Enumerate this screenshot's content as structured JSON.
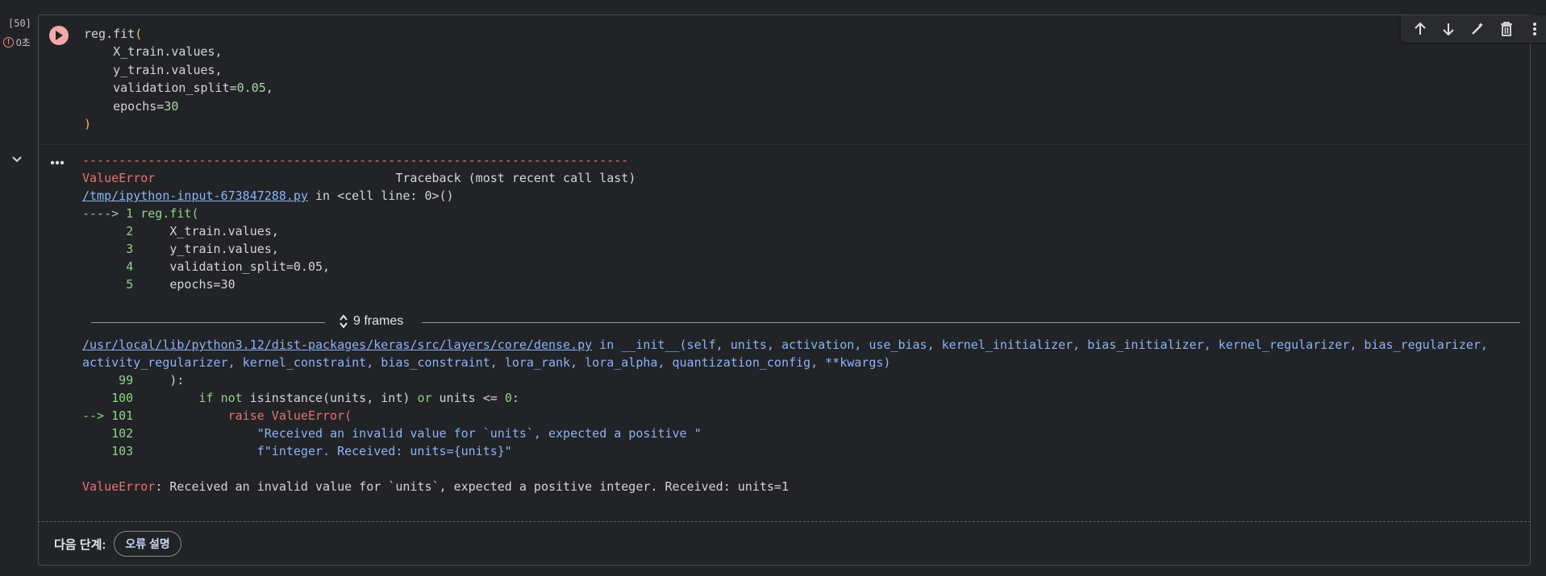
{
  "cell": {
    "exec_count": "[50]",
    "exec_status": "0초",
    "code_lines": [
      "reg.fit(",
      "    X_train.values,",
      "    y_train.values,",
      "    validation_split=0.05,",
      "    epochs=30",
      ")"
    ]
  },
  "toolbar": {
    "icons": [
      "arrow-up-icon",
      "arrow-down-icon",
      "edit-icon",
      "delete-icon",
      "more-vert-icon"
    ]
  },
  "output": {
    "separator": "---------------------------------------------------------------------------",
    "error_name": "ValueError",
    "traceback_header": "Traceback (most recent call last)",
    "input_file": "/tmp/ipython-input-673847288.py",
    "in_text": " in ",
    "cell_location": "<cell line: 0>()",
    "arrow_line_prefix": "----> 1 ",
    "arrow_line_code": "reg.fit(",
    "context_lines": [
      {
        "num": "2",
        "code": "X_train.values,"
      },
      {
        "num": "3",
        "code": "y_train.values,"
      },
      {
        "num": "4",
        "code": "validation_split=0.05,"
      },
      {
        "num": "5",
        "code": "epochs=30"
      }
    ],
    "frames_label": "9 frames",
    "lib_file": "/usr/local/lib/python3.12/dist-packages/keras/src/layers/core/dense.py",
    "func_sig_line1": " in __init__(self, units, activation, use_bias, kernel_initializer, bias_initializer, kernel_regularizer, bias_regularizer,",
    "func_sig_line2": "activity_regularizer, kernel_constraint, bias_constraint, lora_rank, lora_alpha, quantization_config, **kwargs)",
    "lib_lines": [
      {
        "num": "99",
        "code": "):"
      },
      {
        "num": "100",
        "code": "if not isinstance(units, int) or units <= 0:"
      },
      {
        "num": "101",
        "code": "raise ValueError("
      },
      {
        "num": "102",
        "code": "\"Received an invalid value for `units`, expected a positive \""
      },
      {
        "num": "103",
        "code": "f\"integer. Received: units={units}\""
      }
    ],
    "lib_arrow": "--> ",
    "final_error_name": "ValueError",
    "final_error_msg": ": Received an invalid value for `units`, expected a positive integer. Received: units=1"
  },
  "next_steps": {
    "label": "다음 단계:",
    "chip": "오류 설명"
  }
}
